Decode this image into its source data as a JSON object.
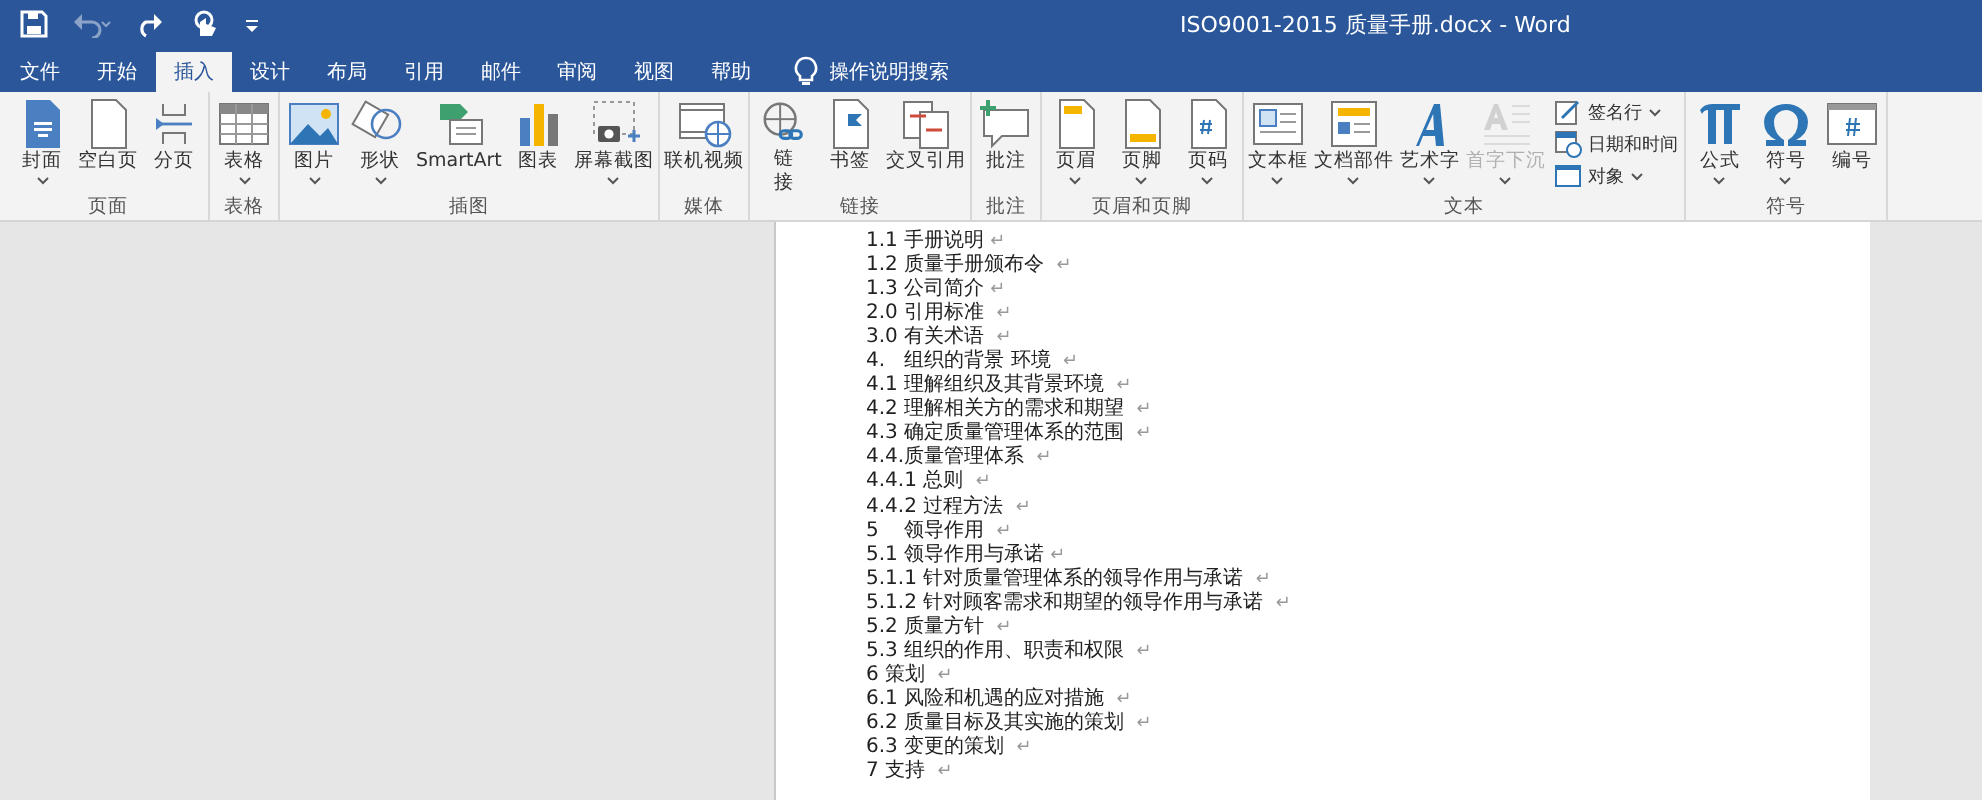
{
  "window": {
    "title": "ISO9001-2015 质量手册.docx  -  Word"
  },
  "quick_access": [
    {
      "kind": "save",
      "disabled": false
    },
    {
      "kind": "undo",
      "disabled": true
    },
    {
      "kind": "redo",
      "disabled": false
    },
    {
      "kind": "touch",
      "disabled": false
    },
    {
      "kind": "customize",
      "disabled": false
    }
  ],
  "tabs": [
    {
      "label": "文件",
      "selected": false
    },
    {
      "label": "开始",
      "selected": false
    },
    {
      "label": "插入",
      "selected": true
    },
    {
      "label": "设计",
      "selected": false
    },
    {
      "label": "布局",
      "selected": false
    },
    {
      "label": "引用",
      "selected": false
    },
    {
      "label": "邮件",
      "selected": false
    },
    {
      "label": "审阅",
      "selected": false
    },
    {
      "label": "视图",
      "selected": false
    },
    {
      "label": "帮助",
      "selected": false
    }
  ],
  "tell_me": {
    "placeholder": "操作说明搜索"
  },
  "ribbon_groups": [
    {
      "label": "页面",
      "buttons": [
        {
          "label": "封面",
          "dropdown": true,
          "disabled": false,
          "wrap": false
        },
        {
          "label": "空白页",
          "dropdown": false,
          "disabled": false,
          "wrap": false
        },
        {
          "label": "分页",
          "dropdown": false,
          "disabled": false,
          "wrap": false
        }
      ]
    },
    {
      "label": "表格",
      "buttons": [
        {
          "label": "表格",
          "dropdown": true,
          "disabled": false,
          "wrap": false
        }
      ]
    },
    {
      "label": "插图",
      "buttons": [
        {
          "label": "图片",
          "dropdown": true,
          "disabled": false,
          "wrap": false
        },
        {
          "label": "形状",
          "dropdown": true,
          "disabled": false,
          "wrap": false
        },
        {
          "label": "SmartArt",
          "dropdown": false,
          "disabled": false,
          "wrap": false
        },
        {
          "label": "图表",
          "dropdown": false,
          "disabled": false,
          "wrap": false
        },
        {
          "label": "屏幕截图",
          "dropdown": true,
          "disabled": false,
          "wrap": false
        }
      ]
    },
    {
      "label": "媒体",
      "buttons": [
        {
          "label": "联机视频",
          "dropdown": false,
          "disabled": false,
          "wrap": false
        }
      ]
    },
    {
      "label": "链接",
      "buttons": [
        {
          "label": "链接",
          "dropdown": false,
          "disabled": false,
          "wrap": true
        },
        {
          "label": "书签",
          "dropdown": false,
          "disabled": false,
          "wrap": false
        },
        {
          "label": "交叉引用",
          "dropdown": false,
          "disabled": false,
          "wrap": false
        }
      ]
    },
    {
      "label": "批注",
      "buttons": [
        {
          "label": "批注",
          "dropdown": false,
          "disabled": false,
          "wrap": false
        }
      ]
    },
    {
      "label": "页眉和页脚",
      "buttons": [
        {
          "label": "页眉",
          "dropdown": true,
          "disabled": false,
          "wrap": false
        },
        {
          "label": "页脚",
          "dropdown": true,
          "disabled": false,
          "wrap": false
        },
        {
          "label": "页码",
          "dropdown": true,
          "disabled": false,
          "wrap": false
        }
      ]
    },
    {
      "label": "文本",
      "buttons": [
        {
          "label": "文本框",
          "dropdown": true,
          "disabled": false,
          "wrap": false
        },
        {
          "label": "文档部件",
          "dropdown": true,
          "disabled": false,
          "wrap": false
        },
        {
          "label": "艺术字",
          "dropdown": true,
          "disabled": false,
          "wrap": false
        },
        {
          "label": "首字下沉",
          "dropdown": true,
          "disabled": true,
          "wrap": false
        }
      ],
      "small_buttons": [
        {
          "label": "签名行",
          "dropdown": true
        },
        {
          "label": "日期和时间",
          "dropdown": false
        },
        {
          "label": "对象",
          "dropdown": true
        }
      ]
    },
    {
      "label": "符号",
      "buttons": [
        {
          "label": "公式",
          "dropdown": true,
          "disabled": false,
          "wrap": false
        },
        {
          "label": "符号",
          "dropdown": true,
          "disabled": false,
          "wrap": false
        },
        {
          "label": "编号",
          "dropdown": false,
          "disabled": false,
          "wrap": false
        }
      ]
    }
  ],
  "document": {
    "lines": [
      {
        "text": "1.1 手册说明",
        "mark": "↵"
      },
      {
        "text": "1.2 质量手册颁布令 ",
        "mark": "↵"
      },
      {
        "text": "1.3 公司简介",
        "mark": "↵"
      },
      {
        "text": "2.0 引用标准 ",
        "mark": "↵"
      },
      {
        "text": "3.0 有关术语 ",
        "mark": "↵"
      },
      {
        "text": "4.   组织的背景 环境 ",
        "mark": "↵"
      },
      {
        "text": "4.1 理解组织及其背景环境 ",
        "mark": "↵"
      },
      {
        "text": "4.2 理解相关方的需求和期望 ",
        "mark": "↵"
      },
      {
        "text": "4.3 确定质量管理体系的范围 ",
        "mark": "↵"
      },
      {
        "text": "4.4.质量管理体系 ",
        "mark": "↵"
      },
      {
        "text": "4.4.1 总则 ",
        "mark": "↵"
      },
      {
        "text": "4.4.2 过程方法 ",
        "mark": "↵"
      },
      {
        "text": "5    领导作用 ",
        "mark": "↵"
      },
      {
        "text": "5.1 领导作用与承诺",
        "mark": "↵"
      },
      {
        "text": "5.1.1 针对质量管理体系的领导作用与承诺 ",
        "mark": "↵"
      },
      {
        "text": "5.1.2 针对顾客需求和期望的领导作用与承诺 ",
        "mark": "↵"
      },
      {
        "text": "5.2 质量方针 ",
        "mark": "↵"
      },
      {
        "text": "5.3 组织的作用、职责和权限 ",
        "mark": "↵"
      },
      {
        "text": "6 策划 ",
        "mark": "↵"
      },
      {
        "text": "6.1 风险和机遇的应对措施 ",
        "mark": "↵"
      },
      {
        "text": "6.2 质量目标及其实施的策划 ",
        "mark": "↵"
      },
      {
        "text": "6.3 变更的策划 ",
        "mark": "↵"
      },
      {
        "text": "7 支持 ",
        "mark": "↵"
      }
    ]
  }
}
